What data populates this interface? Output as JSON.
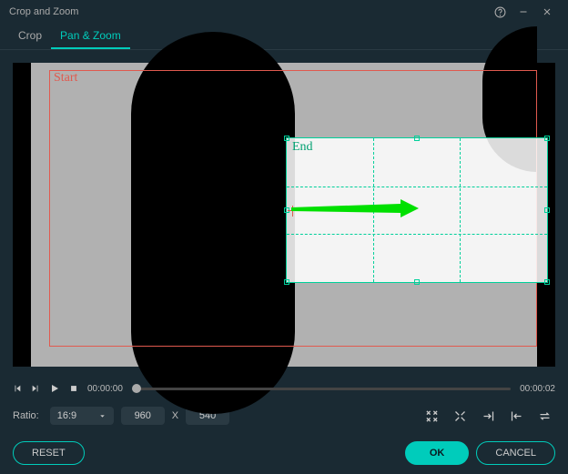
{
  "window": {
    "title": "Crop and Zoom"
  },
  "tabs": [
    {
      "label": "Crop",
      "active": false
    },
    {
      "label": "Pan & Zoom",
      "active": true
    }
  ],
  "overlay": {
    "start_label": "Start",
    "end_label": "End"
  },
  "playback": {
    "current_time": "00:00:00",
    "end_time": "00:00:02"
  },
  "ratio": {
    "label": "Ratio:",
    "selected": "16:9",
    "width": "960",
    "x": "X",
    "height": "540"
  },
  "footer": {
    "reset": "RESET",
    "ok": "OK",
    "cancel": "CANCEL"
  }
}
